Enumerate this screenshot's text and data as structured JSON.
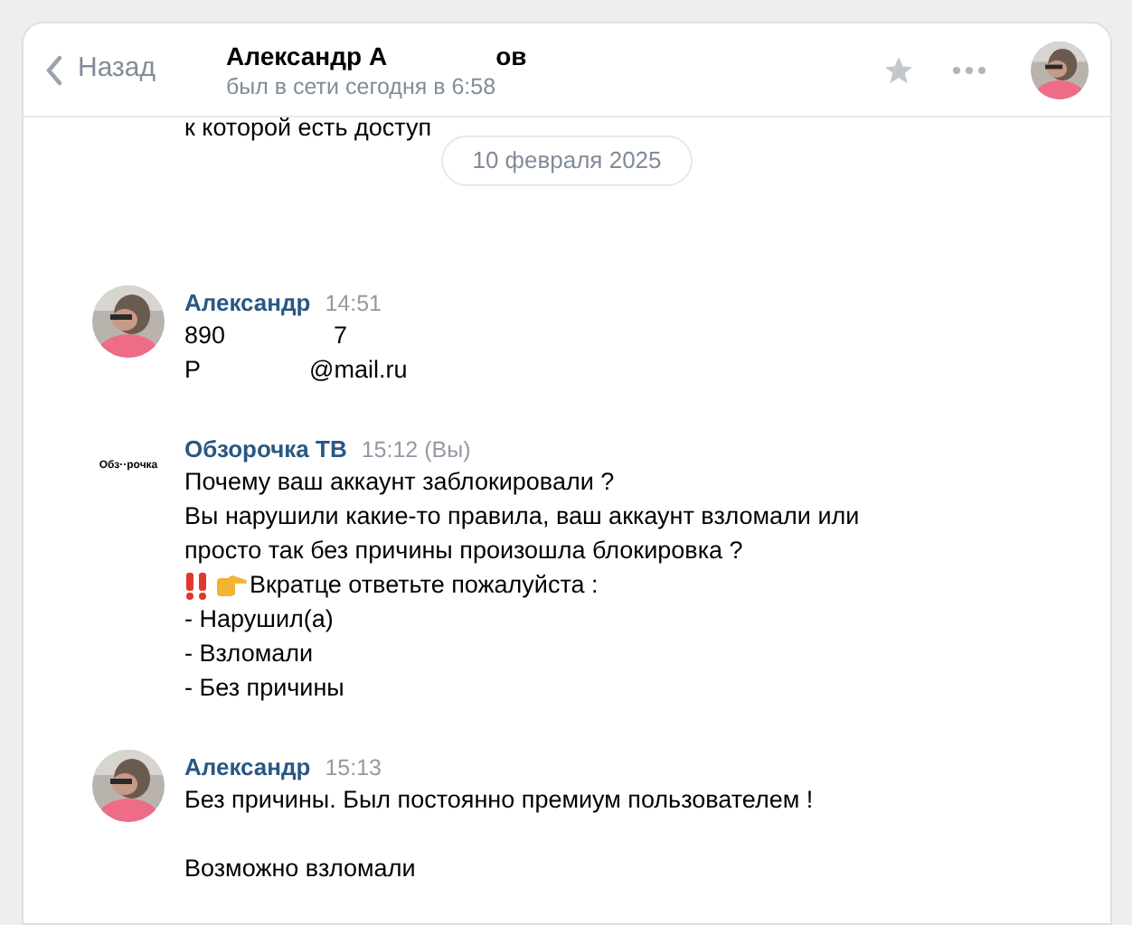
{
  "header": {
    "back": "Назад",
    "name_parts": [
      "Александр А",
      "ов"
    ],
    "status": "был в сети сегодня в 6:58"
  },
  "previous_line": "к которой есть доступ",
  "date": "10 февраля 2025",
  "messages": [
    {
      "author": "Александр",
      "time": "14:51",
      "kind": "picture",
      "lines": [
        {
          "kind": "plain",
          "parts": [
            "890",
            "7"
          ]
        },
        {
          "kind": "plain",
          "parts": [
            "Р",
            "@mail.ru"
          ]
        }
      ]
    },
    {
      "author": "Обзорочка ТВ",
      "time": "15:12 (Вы)",
      "kind": "logo",
      "logo_text": "Обз··рочка",
      "lines": [
        {
          "kind": "plain",
          "parts": [
            "Почему ваш аккаунт заблокировали ?"
          ]
        },
        {
          "kind": "plain",
          "parts": [
            "Вы нарушили какие-то правила, ваш аккаунт взломали или"
          ]
        },
        {
          "kind": "plain",
          "parts": [
            "просто так без причины произошла блокировка ?"
          ]
        },
        {
          "kind": "emphasis",
          "parts": [
            "Вкратце ответьте пожалуйста :"
          ]
        },
        {
          "kind": "plain",
          "parts": [
            "- Нарушил(а)"
          ]
        },
        {
          "kind": "plain",
          "parts": [
            "- Взломали"
          ]
        },
        {
          "kind": "plain",
          "parts": [
            "- Без причины"
          ]
        }
      ]
    },
    {
      "author": "Александр",
      "time": "15:13",
      "kind": "picture",
      "lines": [
        {
          "kind": "plain",
          "parts": [
            "Без причины. Был постоянно премиум пользователем !"
          ]
        },
        {
          "kind": "gap"
        },
        {
          "kind": "plain",
          "parts": [
            "Возможно взломали"
          ]
        }
      ]
    }
  ]
}
